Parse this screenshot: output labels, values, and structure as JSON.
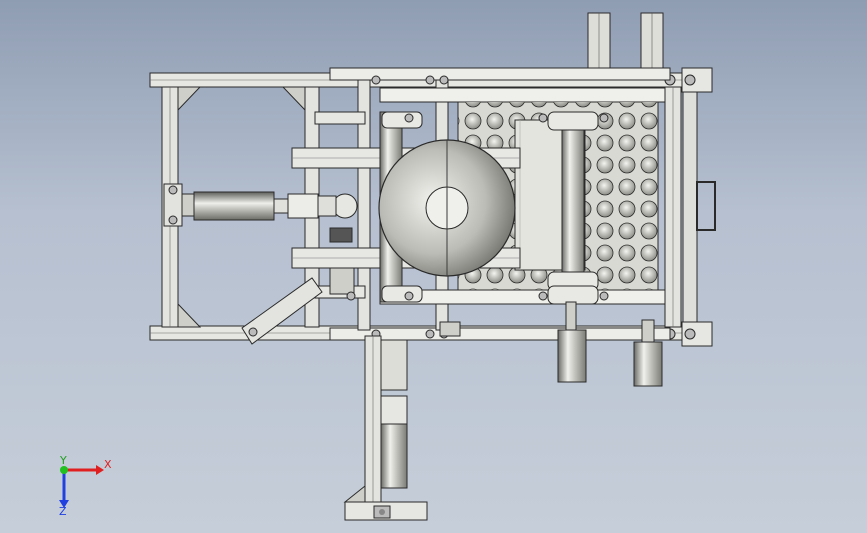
{
  "viewport": {
    "background_top": "#8f9db3",
    "background_bottom": "#c6ced9"
  },
  "triad": {
    "x_label": "X",
    "y_label": "Y",
    "z_label": "Z",
    "x_color": "#e02020",
    "y_color": "#20c020",
    "z_color": "#2040e0"
  },
  "model": {
    "frame_color": "#e8e8e4",
    "edge_color": "#2a2a2a",
    "steel_color": "#c9c9c5"
  }
}
